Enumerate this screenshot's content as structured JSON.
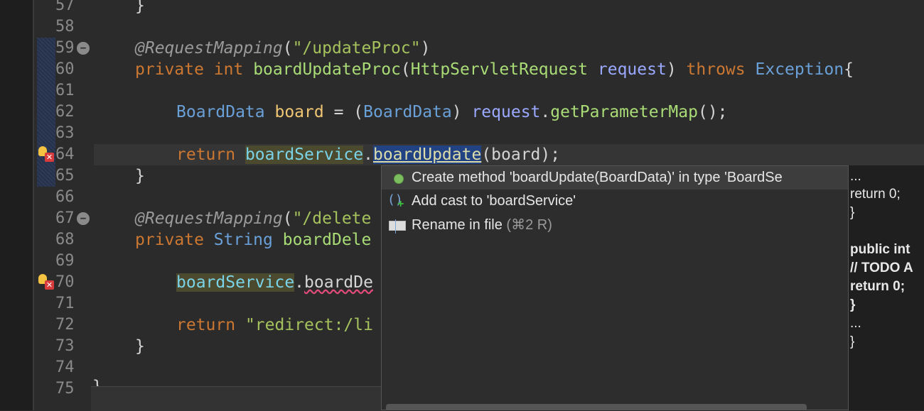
{
  "editor": {
    "lines": [
      {
        "no": "57"
      },
      {
        "no": "58"
      },
      {
        "no": "59"
      },
      {
        "no": "60"
      },
      {
        "no": "61"
      },
      {
        "no": "62"
      },
      {
        "no": "63"
      },
      {
        "no": "64"
      },
      {
        "no": "65"
      },
      {
        "no": "66"
      },
      {
        "no": "67"
      },
      {
        "no": "68"
      },
      {
        "no": "69"
      },
      {
        "no": "70"
      },
      {
        "no": "71"
      },
      {
        "no": "72"
      },
      {
        "no": "73"
      },
      {
        "no": "74"
      },
      {
        "no": "75"
      }
    ],
    "code": {
      "l57_brace": "}",
      "l59_ann": "@RequestMapping",
      "l59_paren_open": "(",
      "l59_str": "\"/updateProc\"",
      "l59_paren_close": ")",
      "l60_private": "private",
      "l60_int": "int",
      "l60_method": "boardUpdateProc",
      "l60_paren": "(",
      "l60_type": "HttpServletRequest",
      "l60_param": "request",
      "l60_close": ")",
      "l60_throws": "throws",
      "l60_exc": "Exception",
      "l60_brace": "{",
      "l62_type": "BoardData",
      "l62_var": "board",
      "l62_eq": " = (",
      "l62_cast": "BoardData",
      "l62_close": ") ",
      "l62_req": "request",
      "l62_dot": ".",
      "l62_call": "getParameterMap",
      "l62_end": "();",
      "l64_return": "return",
      "l64_field": "boardService",
      "l64_dot": ".",
      "l64_method": "boardUpdate",
      "l64_args": "(board);",
      "l65_brace": "}",
      "l67_ann": "@RequestMapping",
      "l67_paren": "(",
      "l67_str": "\"/delete",
      "l68_private": "private",
      "l68_type": "String",
      "l68_method": "boardDele",
      "l70_field": "boardService",
      "l70_dot": ".",
      "l70_method": "boardDe",
      "l72_return": "return",
      "l72_str": "\"redirect:/li",
      "l73_brace": "}",
      "l75_brace": "}"
    }
  },
  "quickfix": {
    "items": [
      {
        "label": "Create method 'boardUpdate(BoardData)' in type 'BoardSe",
        "icon": "green-dot-icon"
      },
      {
        "label": "Add cast to 'boardService'",
        "icon": "cast-add-icon"
      },
      {
        "label": "Rename in file",
        "shortcut": "(⌘2 R)",
        "icon": "rename-icon"
      }
    ],
    "preview": {
      "ellipsis_top": "...",
      "lines": [
        "return 0;",
        "}",
        "",
        "public int",
        "// TODO A",
        "return 0;",
        "}",
        "...",
        "}"
      ]
    }
  },
  "colors": {
    "background": "#2b2b2b",
    "keyword": "#cc7832",
    "type": "#6aa0d8",
    "string": "#a5c25c",
    "selection": "#214283",
    "error": "#d83b3b"
  }
}
